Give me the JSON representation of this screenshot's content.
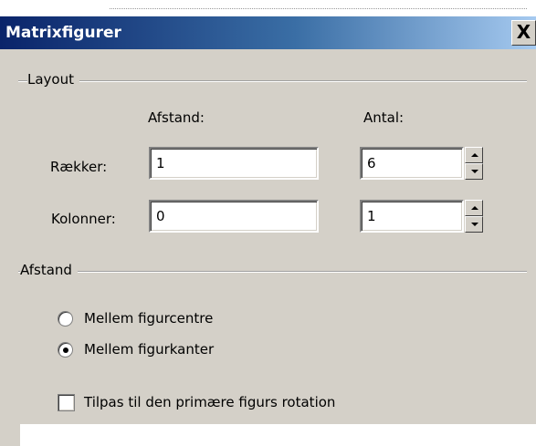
{
  "window": {
    "title": "Matrixfigurer",
    "close_label": "X"
  },
  "layout_group": {
    "label": "Layout",
    "col_spacing_header": "Afstand:",
    "col_count_header": "Antal:",
    "rows": {
      "label": "Rækker:",
      "spacing_value": "1",
      "count_value": "6"
    },
    "columns": {
      "label": "Kolonner:",
      "spacing_value": "0",
      "count_value": "1"
    }
  },
  "spacing_group": {
    "label": "Afstand",
    "options": [
      {
        "label": "Mellem figurcentre",
        "selected": false
      },
      {
        "label": "Mellem figurkanter",
        "selected": true
      }
    ],
    "rotation_checkbox": {
      "label": "Tilpas til den primære figurs rotation",
      "checked": false
    }
  }
}
